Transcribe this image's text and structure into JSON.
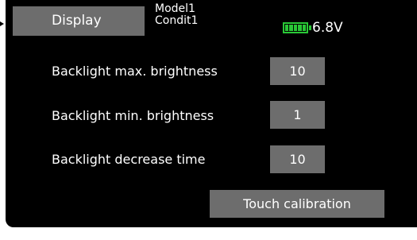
{
  "header": {
    "title": "Display",
    "model_name": "Model1",
    "condition_name": "Condit1",
    "battery_voltage": "6.8V",
    "battery_level": 1.0,
    "battery_color": "#29c736"
  },
  "settings": [
    {
      "label": "Backlight max. brightness",
      "value": "10"
    },
    {
      "label": "Backlight min. brightness",
      "value": "1"
    },
    {
      "label": "Backlight decrease time",
      "value": "10"
    }
  ],
  "actions": {
    "touch_calibration_label": "Touch calibration"
  },
  "colors": {
    "background": "#000000",
    "button": "#6d6d6d",
    "text": "#ffffff"
  }
}
